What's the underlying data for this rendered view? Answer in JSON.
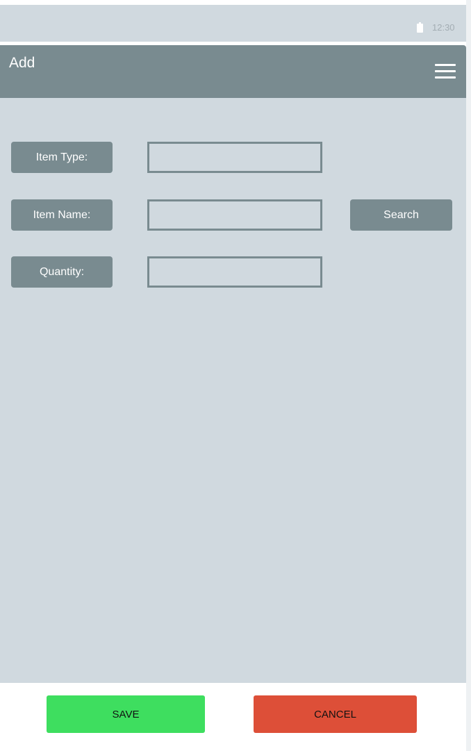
{
  "status_bar": {
    "time": "12:30",
    "battery_icon": "battery-icon"
  },
  "app_bar": {
    "title": "Add",
    "menu_icon": "hamburger-menu-icon"
  },
  "form": {
    "item_type_label": "Item Type:",
    "item_type_value": "",
    "item_name_label": "Item Name:",
    "item_name_value": "",
    "quantity_label": "Quantity:",
    "quantity_value": "",
    "search_label": "Search"
  },
  "footer": {
    "save_label": "SAVE",
    "cancel_label": "CANCEL"
  },
  "colors": {
    "background": "#d0d9df",
    "accent": "#798b90",
    "save": "#3ede5f",
    "cancel": "#dd4f38"
  }
}
